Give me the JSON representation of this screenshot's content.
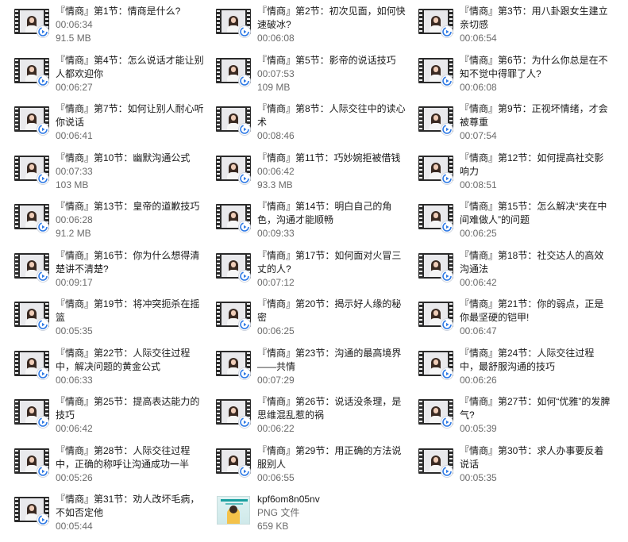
{
  "files": [
    {
      "name": "『情商』第1节：情商是什么?",
      "duration": "00:06:34",
      "size": "91.5 MB",
      "type": "video"
    },
    {
      "name": "『情商』第2节：初次见面，如何快速破冰?",
      "duration": "00:06:08",
      "size": "",
      "type": "video"
    },
    {
      "name": "『情商』第3节：用八卦跟女生建立亲切感",
      "duration": "00:06:54",
      "size": "",
      "type": "video"
    },
    {
      "name": "『情商』第4节：怎么说话才能让别人都欢迎你",
      "duration": "00:06:27",
      "size": "",
      "type": "video"
    },
    {
      "name": "『情商』第5节：影帝的说话技巧",
      "duration": "00:07:53",
      "size": "109 MB",
      "type": "video"
    },
    {
      "name": "『情商』第6节：为什么你总是在不知不觉中得罪了人?",
      "duration": "00:06:08",
      "size": "",
      "type": "video"
    },
    {
      "name": "『情商』第7节：如何让别人耐心听你说话",
      "duration": "00:06:41",
      "size": "",
      "type": "video"
    },
    {
      "name": "『情商』第8节：人际交往中的读心术",
      "duration": "00:08:46",
      "size": "",
      "type": "video"
    },
    {
      "name": "『情商』第9节：正视坏情绪，才会被尊重",
      "duration": "00:07:54",
      "size": "",
      "type": "video"
    },
    {
      "name": "『情商』第10节：幽默沟通公式",
      "duration": "00:07:33",
      "size": "103 MB",
      "type": "video"
    },
    {
      "name": "『情商』第11节：巧妙婉拒被借钱",
      "duration": "00:06:42",
      "size": "93.3 MB",
      "type": "video"
    },
    {
      "name": "『情商』第12节：如何提高社交影响力",
      "duration": "00:08:51",
      "size": "",
      "type": "video"
    },
    {
      "name": "『情商』第13节：皇帝的道歉技巧",
      "duration": "00:06:28",
      "size": "91.2 MB",
      "type": "video"
    },
    {
      "name": "『情商』第14节：明白自己的角色，沟通才能顺畅",
      "duration": "00:09:33",
      "size": "",
      "type": "video"
    },
    {
      "name": "『情商』第15节：怎么解决“夹在中间难做人”的问题",
      "duration": "00:06:25",
      "size": "",
      "type": "video"
    },
    {
      "name": "『情商』第16节：你为什么想得清楚讲不清楚?",
      "duration": "00:09:17",
      "size": "",
      "type": "video"
    },
    {
      "name": "『情商』第17节：如何面对火冒三丈的人?",
      "duration": "00:07:12",
      "size": "",
      "type": "video"
    },
    {
      "name": "『情商』第18节：社交达人的高效沟通法",
      "duration": "00:06:42",
      "size": "",
      "type": "video"
    },
    {
      "name": "『情商』第19节：将冲突扼杀在摇篮",
      "duration": "00:05:35",
      "size": "",
      "type": "video"
    },
    {
      "name": "『情商』第20节：揭示好人缘的秘密",
      "duration": "00:06:25",
      "size": "",
      "type": "video"
    },
    {
      "name": "『情商』第21节：你的弱点，正是你最坚硬的铠甲!",
      "duration": "00:06:47",
      "size": "",
      "type": "video"
    },
    {
      "name": "『情商』第22节：人际交往过程中，解决问题的黄金公式",
      "duration": "00:06:33",
      "size": "",
      "type": "video"
    },
    {
      "name": "『情商』第23节：沟通的最高境界——共情",
      "duration": "00:07:29",
      "size": "",
      "type": "video"
    },
    {
      "name": "『情商』第24节：人际交往过程中，最舒服沟通的技巧",
      "duration": "00:06:26",
      "size": "",
      "type": "video"
    },
    {
      "name": "『情商』第25节：提高表达能力的技巧",
      "duration": "00:06:42",
      "size": "",
      "type": "video"
    },
    {
      "name": "『情商』第26节：说话没条理，是思维混乱惹的祸",
      "duration": "00:06:22",
      "size": "",
      "type": "video"
    },
    {
      "name": "『情商』第27节：如何“优雅”的发脾气?",
      "duration": "00:05:39",
      "size": "",
      "type": "video"
    },
    {
      "name": "『情商』第28节：人际交往过程中，正确的称呼让沟通成功一半",
      "duration": "00:05:26",
      "size": "",
      "type": "video"
    },
    {
      "name": "『情商』第29节：用正确的方法说服别人",
      "duration": "00:06:55",
      "size": "",
      "type": "video"
    },
    {
      "name": "『情商』第30节：求人办事要反着说话",
      "duration": "00:05:35",
      "size": "",
      "type": "video"
    },
    {
      "name": "『情商』第31节：劝人改坏毛病，不如否定他",
      "duration": "00:05:44",
      "size": "",
      "type": "video"
    },
    {
      "name": "kpf6om8n05nv",
      "duration": "PNG 文件",
      "size": "659 KB",
      "type": "image"
    }
  ],
  "colors": {
    "text": "#1a1a1a",
    "subtext": "#6b6b6b",
    "badge_blue": "#2f7ae5"
  },
  "icons": {
    "video_thumbnail": "film-strip-icon",
    "video_badge": "media-player-badge-icon",
    "image_thumbnail": "png-thumbnail"
  }
}
